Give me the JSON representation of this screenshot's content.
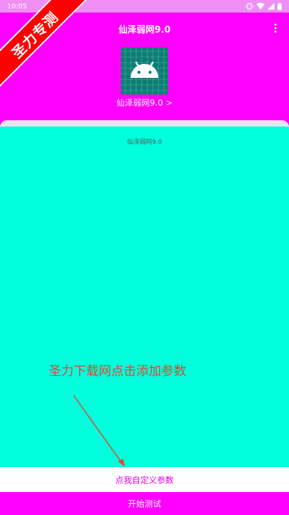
{
  "status_bar": {
    "time": "10:05",
    "icons": [
      "vibrate-icon",
      "wifi-icon",
      "signal-icon",
      "battery-icon"
    ]
  },
  "app_bar": {
    "title": "仙泽弱网9.0",
    "menu_icon": "more-vert-icon"
  },
  "header": {
    "app_icon": "android-icon",
    "app_name": "仙泽弱网9.0 >"
  },
  "card": {
    "subtitle": "仙泽弱网9.0",
    "annotation": "圣力下载网点击添加参数"
  },
  "actions": {
    "custom_params": "点我自定义参数",
    "start_test": "开始测试"
  },
  "watermark": {
    "text": "圣力专测"
  },
  "colors": {
    "primary": "#ff00ff",
    "card": "#00ffdd",
    "annotation": "#e2452f",
    "ribbon": "#ff0000"
  }
}
